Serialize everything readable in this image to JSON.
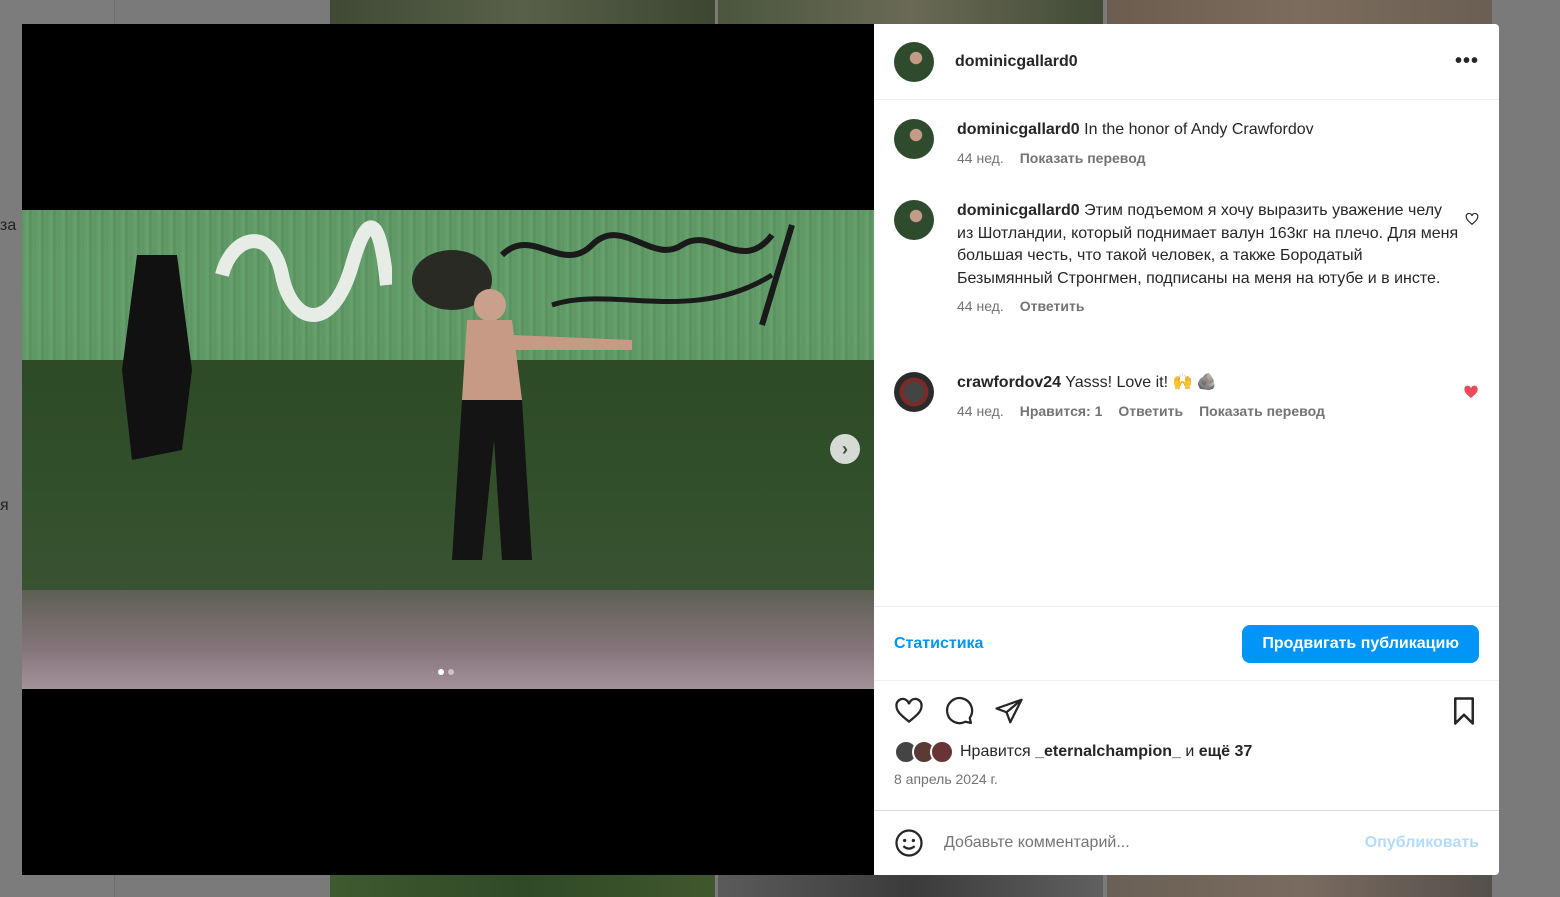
{
  "background": {
    "left_labels": [
      "за",
      "я"
    ]
  },
  "media": {
    "carousel_dots": 2,
    "active_dot": 0,
    "next_icon": "chevron-right-icon"
  },
  "post": {
    "author": "dominicgallard0",
    "more_icon": "more-horizontal-icon"
  },
  "comments": [
    {
      "username": "dominicgallard0",
      "text": "In the honor of Andy Crawfordov",
      "time": "44 нед.",
      "actions": [
        "Показать перевод"
      ]
    },
    {
      "username": "dominicgallard0",
      "text": "Этим подъемом я хочу выразить уважение челу из Шотландии, который поднимает валун 163кг на плечо. Для меня большая честь, что такой человек, а также Бородатый Безымянный Стронгмен, подписаны на меня на ютубе и в инсте.",
      "time": "44 нед.",
      "actions": [
        "Ответить"
      ],
      "liked": false
    },
    {
      "username": "crawfordov24",
      "text": "Yasss! Love it! 🙌 🪨",
      "time": "44 нед.",
      "likes_label": "Нравится: 1",
      "actions": [
        "Ответить",
        "Показать перевод"
      ],
      "liked": true
    }
  ],
  "stats": {
    "link": "Статистика",
    "promote_button": "Продвигать публикацию"
  },
  "likes": {
    "prefix": "Нравится",
    "user": "_eternalchampion_",
    "joiner": "и",
    "rest": "ещё 37"
  },
  "date": "8 апрель 2024 г.",
  "comment_box": {
    "placeholder": "Добавьте комментарий...",
    "publish": "Опубликовать"
  },
  "colors": {
    "accent": "#0095f6",
    "liked": "#ed4956",
    "muted": "#737373"
  }
}
